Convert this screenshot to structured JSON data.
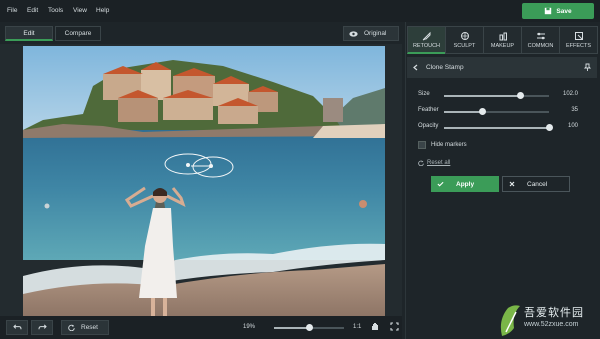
{
  "menu": [
    "File",
    "Edit",
    "Tools",
    "View",
    "Help"
  ],
  "save_label": "Save",
  "view_tabs": {
    "edit": "Edit",
    "compare": "Compare"
  },
  "original_label": "Original",
  "bottom": {
    "reset_label": "Reset",
    "zoom_label": "19%",
    "zoom_level": 0.5,
    "ratio_label": "1:1"
  },
  "tool_tabs": [
    "RETOUCH",
    "SCULPT",
    "MAKEUP",
    "COMMON",
    "EFFECTS"
  ],
  "panel": {
    "title": "Clone Stamp",
    "sliders": [
      {
        "label": "Size",
        "value": "102.0",
        "level": 0.72
      },
      {
        "label": "Feather",
        "value": "35",
        "level": 0.36
      },
      {
        "label": "Opacity",
        "value": "100",
        "level": 1.0
      }
    ],
    "hide_markers": "Hide markers",
    "reset_all": "Reset all",
    "apply": "Apply",
    "cancel": "Cancel"
  },
  "watermark": {
    "line1": "吾爱软件园",
    "line2": "www.52zxue.com"
  },
  "colors": {
    "accent": "#3b9c58",
    "background": "#1e2529"
  }
}
